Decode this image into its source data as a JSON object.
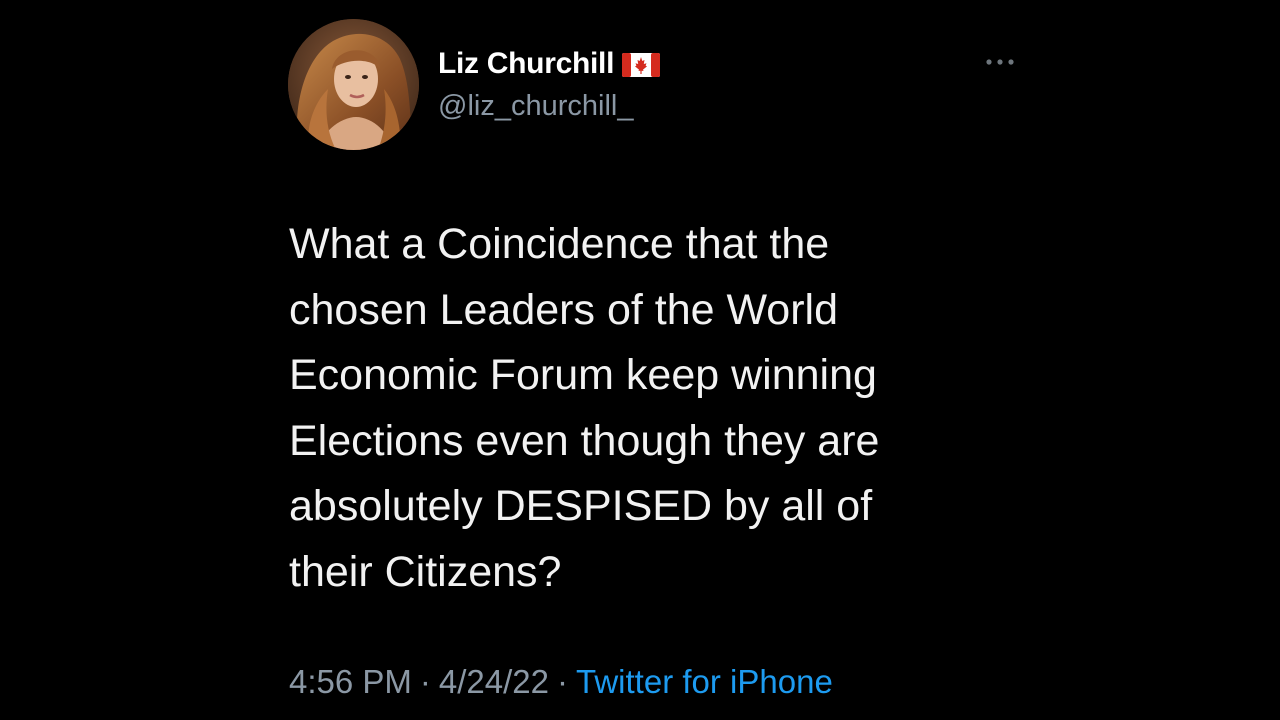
{
  "tweet": {
    "author": {
      "display_name": "Liz Churchill",
      "handle": "@liz_churchill_",
      "flag_icon": "canada-flag-icon",
      "avatar_icon": "profile-photo"
    },
    "more_icon": "more-options-icon",
    "text": "What a Coincidence that the\nchosen Leaders of the World\nEconomic Forum keep winning\nElections even though they are\nabsolutely DESPISED by all of\ntheir Citizens?",
    "meta": {
      "time": "4:56 PM",
      "separator": "·",
      "date": "4/24/22",
      "source": "Twitter for iPhone"
    }
  },
  "colors": {
    "background": "#000000",
    "name": "#ffffff",
    "text": "#f2f2f2",
    "secondary": "#8b98a5",
    "link": "#1d9bf0",
    "flag_red": "#d52b1e"
  }
}
